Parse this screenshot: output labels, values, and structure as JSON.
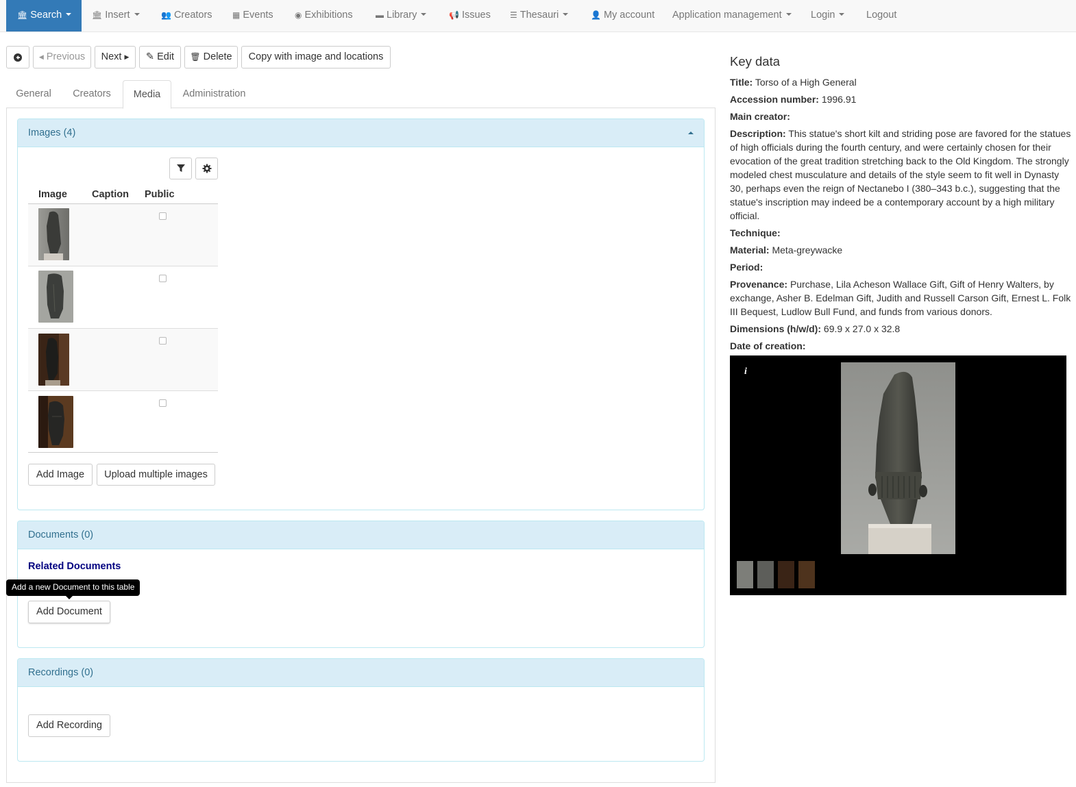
{
  "navbar": {
    "items": [
      {
        "label": "Search",
        "icon": "bank-icon",
        "active": true,
        "dropdown": true
      },
      {
        "label": "Insert",
        "icon": "bank-icon",
        "dropdown": true
      },
      {
        "label": "Creators",
        "icon": "users-icon"
      },
      {
        "label": "Events",
        "icon": "calendar-icon"
      },
      {
        "label": "Exhibitions",
        "icon": "eye-icon"
      },
      {
        "label": "Library",
        "icon": "archive-icon",
        "dropdown": true
      },
      {
        "label": "Issues",
        "icon": "bullhorn-icon"
      },
      {
        "label": "Thesauri",
        "icon": "list-icon",
        "dropdown": true
      },
      {
        "label": "My account",
        "icon": "user-icon"
      },
      {
        "label": "Application management",
        "dropdown": true
      },
      {
        "label": "Login",
        "dropdown": true
      },
      {
        "label": "Logout"
      }
    ],
    "active_color": "#337ab7"
  },
  "toolbar": {
    "previous": "Previous",
    "next": "Next",
    "edit": "Edit",
    "delete": "Delete",
    "copy": "Copy with image and locations"
  },
  "tabs": [
    "General",
    "Creators",
    "Media",
    "Administration"
  ],
  "active_tab": "Media",
  "images_panel": {
    "heading": "Images (4)",
    "columns": [
      "Image",
      "Caption",
      "Public"
    ],
    "rows": [
      {
        "caption": "",
        "public": false
      },
      {
        "caption": "",
        "public": false
      },
      {
        "caption": "",
        "public": false
      },
      {
        "caption": "",
        "public": false
      }
    ],
    "add_image": "Add Image",
    "upload_multiple": "Upload multiple images"
  },
  "documents_panel": {
    "heading": "Documents (0)",
    "subheading": "Related Documents",
    "add_document": "Add Document",
    "tooltip": "Add a new Document to this table"
  },
  "recordings_panel": {
    "heading": "Recordings (0)",
    "add_recording": "Add Recording"
  },
  "key_data": {
    "heading": "Key data",
    "title_label": "Title",
    "title_value": "Torso of a High General",
    "accession_label": "Accession number",
    "accession_value": "1996.91",
    "main_creator_label": "Main creator",
    "description_label": "Description",
    "description_value": "This statue's short kilt and striding pose are favored for the statues of high officials during the fourth century, and were certainly chosen for their evocation of the great tradition stretching back to the Old Kingdom. The strongly modeled chest musculature and details of the style seem to fit well in Dynasty 30, perhaps even the reign of Nectanebo I (380–343 b.c.), suggesting that the statue's inscription may indeed be a contemporary account by a high military official.",
    "technique_label": "Technique",
    "material_label": "Material",
    "material_value": "Meta-greywacke",
    "period_label": "Period",
    "provenance_label": "Provenance",
    "provenance_value": "Purchase, Lila Acheson Wallace Gift, Gift of Henry Walters, by exchange, Asher B. Edelman Gift, Judith and Russell Carson Gift, Ernest L. Folk III Bequest, Ludlow Bull Fund, and funds from various donors.",
    "dimensions_label": "Dimensions (h/w/d)",
    "dimensions_value": "69.9 x 27.0 x 32.8",
    "date_label": "Date of creation",
    "viewer_info": "i"
  }
}
